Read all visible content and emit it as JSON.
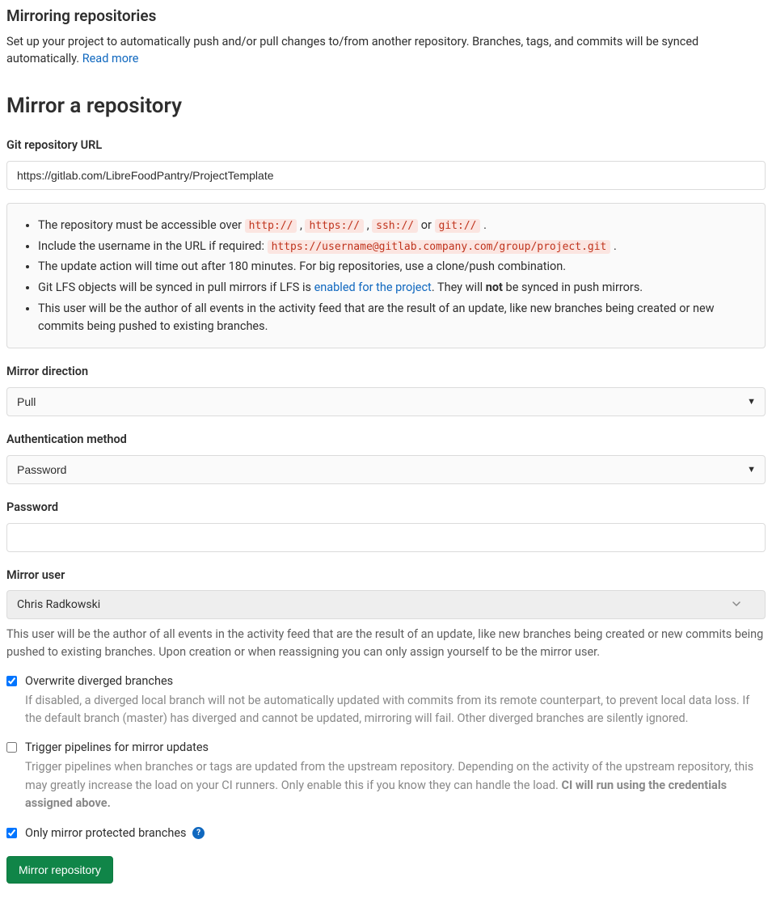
{
  "header": {
    "title": "Mirroring repositories",
    "desc_pre": "Set up your project to automatically push and/or pull changes to/from another repository. Branches, tags, and commits will be synced automatically. ",
    "read_more": "Read more"
  },
  "section": {
    "title": "Mirror a repository"
  },
  "url": {
    "label": "Git repository URL",
    "value": "https://gitlab.com/LibreFoodPantry/ProjectTemplate"
  },
  "help": {
    "li1_pre": "The repository must be accessible over ",
    "proto1": "http://",
    "sep": " , ",
    "proto2": "https://",
    "proto3": "ssh://",
    "or": " or ",
    "proto4": "git://",
    "li1_post": " .",
    "li2_pre": "Include the username in the URL if required: ",
    "li2_code": "https://username@gitlab.company.com/group/project.git",
    "li2_post": " .",
    "li3": "The update action will time out after 180 minutes. For big repositories, use a clone/push combination.",
    "li4_pre": "Git LFS objects will be synced in pull mirrors if LFS is ",
    "li4_link": "enabled for the project",
    "li4_mid": ". They will ",
    "li4_bold": "not",
    "li4_post": " be synced in push mirrors.",
    "li5": "This user will be the author of all events in the activity feed that are the result of an update, like new branches being created or new commits being pushed to existing branches."
  },
  "direction": {
    "label": "Mirror direction",
    "value": "Pull"
  },
  "auth": {
    "label": "Authentication method",
    "value": "Password"
  },
  "password": {
    "label": "Password",
    "value": ""
  },
  "user": {
    "label": "Mirror user",
    "value": "Chris Radkowski",
    "note": "This user will be the author of all events in the activity feed that are the result of an update, like new branches being created or new commits being pushed to existing branches. Upon creation or when reassigning you can only assign yourself to be the mirror user."
  },
  "cb1": {
    "label": "Overwrite diverged branches",
    "checked": true,
    "desc": "If disabled, a diverged local branch will not be automatically updated with commits from its remote counterpart, to prevent local data loss. If the default branch (master) has diverged and cannot be updated, mirroring will fail. Other diverged branches are silently ignored."
  },
  "cb2": {
    "label": "Trigger pipelines for mirror updates",
    "checked": false,
    "desc_pre": "Trigger pipelines when branches or tags are updated from the upstream repository. Depending on the activity of the upstream repository, this may greatly increase the load on your CI runners. Only enable this if you know they can handle the load. ",
    "desc_bold": "CI will run using the credentials assigned above."
  },
  "cb3": {
    "label": "Only mirror protected branches",
    "checked": true
  },
  "submit": {
    "label": "Mirror repository"
  }
}
